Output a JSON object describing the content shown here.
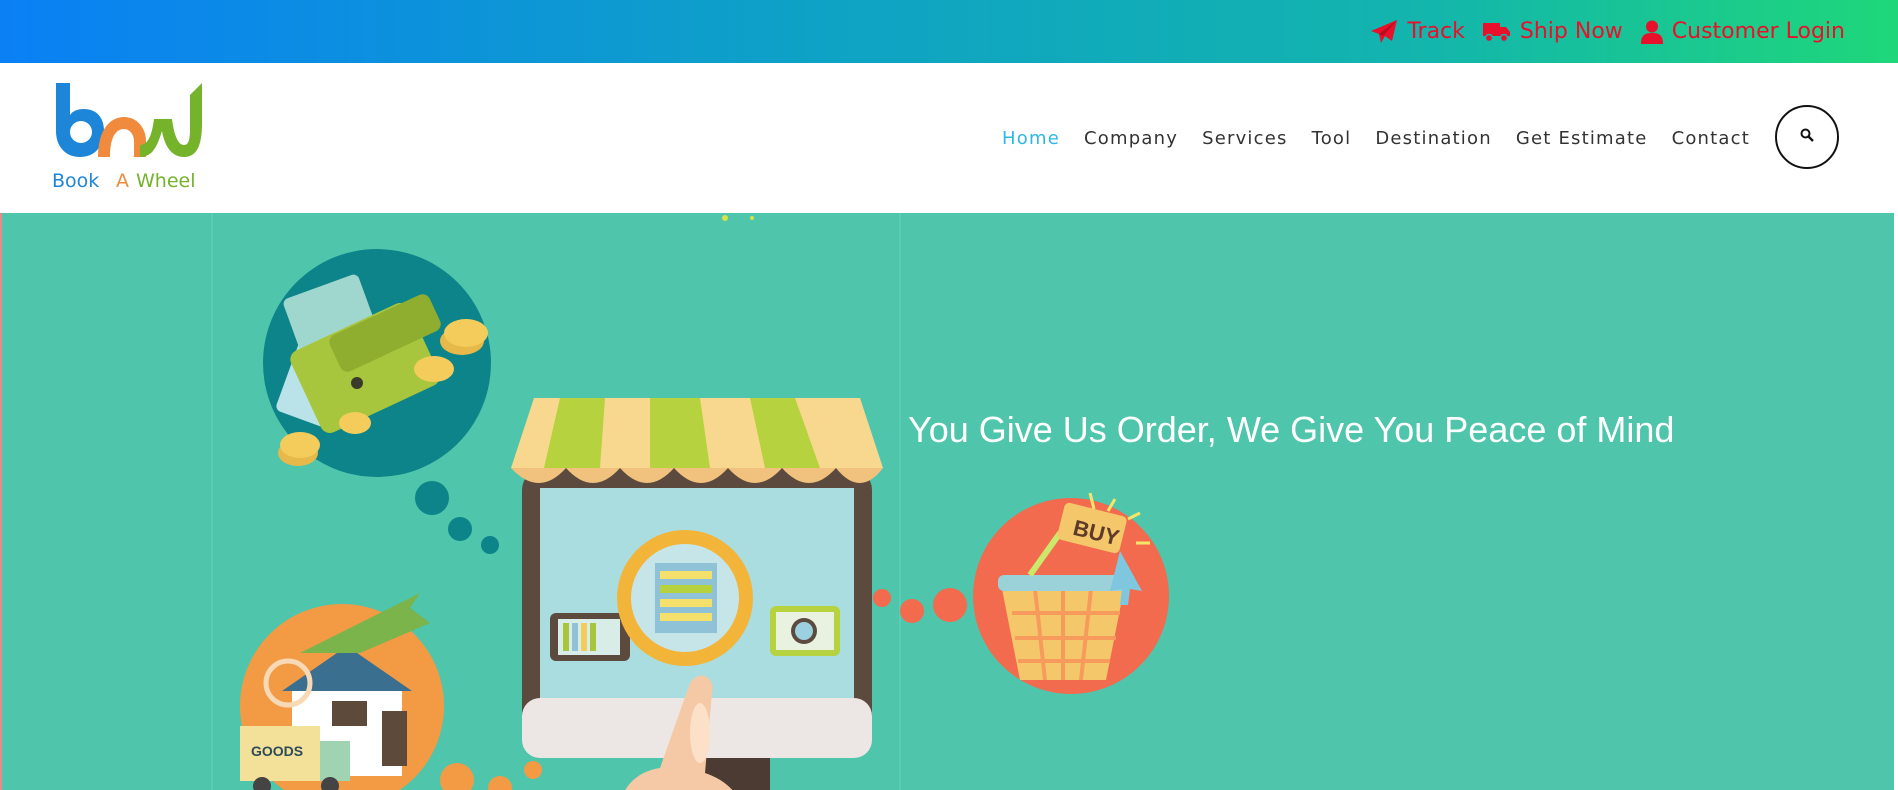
{
  "topbar": {
    "links": [
      {
        "label": "Track",
        "icon": "paper-plane-icon"
      },
      {
        "label": "Ship Now",
        "icon": "truck-icon"
      },
      {
        "label": "Customer Login",
        "icon": "user-icon"
      }
    ],
    "link_color": "#e8102a"
  },
  "logo": {
    "text": "Book A Wheel"
  },
  "nav": {
    "items": [
      {
        "label": "Home",
        "active": true
      },
      {
        "label": "Company"
      },
      {
        "label": "Services"
      },
      {
        "label": "Tool"
      },
      {
        "label": "Destination"
      },
      {
        "label": "Get Estimate"
      },
      {
        "label": "Contact"
      }
    ],
    "search_icon": "search-icon",
    "active_color": "#2bb8e8"
  },
  "hero": {
    "title": "You Give Us Order, We Give You Peace of Mind",
    "background": "#4fc5ab",
    "basket_label": "BUY",
    "package_label": "GOODS"
  }
}
